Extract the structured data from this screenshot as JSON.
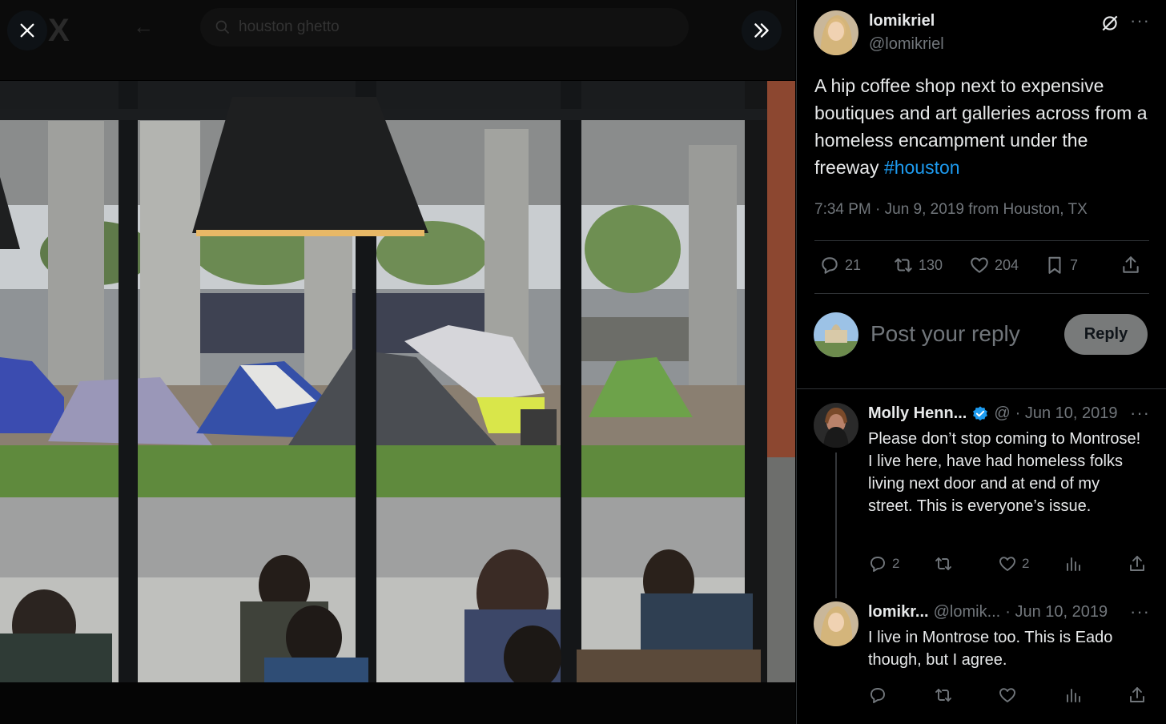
{
  "background_search": {
    "query": "houston ghetto"
  },
  "viewer": {
    "close_icon": "close-icon",
    "expand_icon": "double-chevron-right-icon"
  },
  "tweet": {
    "author_name": "lomikriel",
    "author_handle": "@lomikriel",
    "text_main": "A hip coffee shop next to expensive boutiques and art galleries across from a homeless encampment under the freeway ",
    "hashtag": "#houston",
    "timestamp": "7:34 PM · Jun 9, 2019 from Houston, TX",
    "stats": {
      "replies": "21",
      "retweets": "130",
      "likes": "204",
      "bookmarks": "7"
    }
  },
  "composer": {
    "placeholder": "Post your reply",
    "reply_label": "Reply"
  },
  "replies": [
    {
      "name": "Molly Henn...",
      "verified": true,
      "handle": "@",
      "date": "· Jun 10, 2019",
      "text": "Please don’t stop coming to Montrose! I live here, have had homeless folks living next door and at end of my street. This is everyone’s issue.",
      "reply_count": "2",
      "retweet_count": "",
      "like_count": "2"
    },
    {
      "name": "lomikr...",
      "verified": false,
      "handle": "@lomik...",
      "date": "· Jun 10, 2019",
      "text": "I live in Montrose too. This is Eado though, but I agree.",
      "reply_count": "",
      "retweet_count": "",
      "like_count": ""
    }
  ],
  "colors": {
    "accent": "#1d9bf0",
    "muted": "#71767b",
    "text": "#e7e9ea",
    "divider": "#2f3336"
  }
}
